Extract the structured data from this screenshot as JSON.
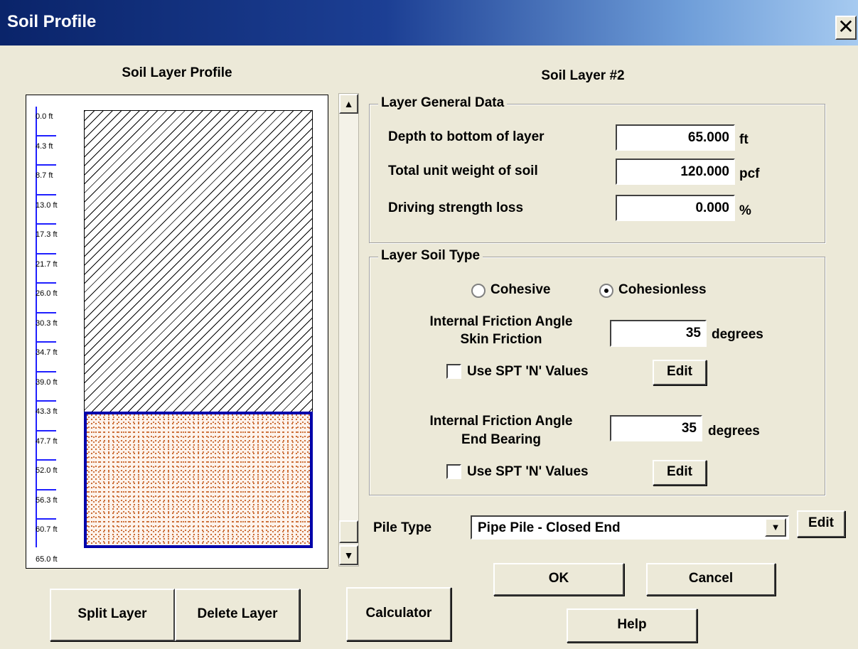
{
  "window": {
    "title": "Soil Profile",
    "close_glyph": "✕"
  },
  "profile": {
    "heading": "Soil Layer Profile",
    "depth_labels": [
      "0.0 ft",
      "4.3 ft",
      "8.7 ft",
      "13.0 ft",
      "17.3 ft",
      "21.7 ft",
      "26.0 ft",
      "30.3 ft",
      "34.7 ft",
      "39.0 ft",
      "43.3 ft",
      "47.7 ft",
      "52.0 ft",
      "56.3 ft",
      "60.7 ft",
      "65.0 ft"
    ],
    "layers": [
      {
        "pattern": "diagonal-hatch"
      },
      {
        "pattern": "sand-dots",
        "selected": true,
        "border_color": "#0000aa"
      }
    ]
  },
  "scroll": {
    "up_glyph": "▲",
    "down_glyph": "▼"
  },
  "layer_heading": "Soil Layer #2",
  "general": {
    "title": "Layer General Data",
    "depth": {
      "label": "Depth to bottom of layer",
      "value": "65.000",
      "unit": "ft"
    },
    "weight": {
      "label": "Total unit weight of soil",
      "value": "120.000",
      "unit": "pcf"
    },
    "loss": {
      "label": "Driving strength loss",
      "value": "0.000",
      "unit": "%"
    }
  },
  "soiltype": {
    "title": "Layer Soil Type",
    "cohesive_label": "Cohesive",
    "cohesionless_label": "Cohesionless",
    "selected": "cohesionless",
    "skin": {
      "label_line1": "Internal Friction Angle",
      "label_line2": "Skin Friction",
      "value": "35",
      "unit": "degrees",
      "spt_label": "Use SPT 'N' Values",
      "spt_checked": false,
      "edit_label": "Edit"
    },
    "end": {
      "label_line1": "Internal Friction Angle",
      "label_line2": "End Bearing",
      "value": "35",
      "unit": "degrees",
      "spt_label": "Use SPT 'N' Values",
      "spt_checked": false,
      "edit_label": "Edit"
    }
  },
  "pile": {
    "label": "Pile Type",
    "selected": "Pipe Pile - Closed End",
    "arrow_glyph": "▼",
    "edit_label": "Edit"
  },
  "buttons": {
    "ok": "OK",
    "cancel": "Cancel",
    "help": "Help",
    "split": "Split Layer",
    "delete": "Delete Layer",
    "calculator": "Calculator"
  },
  "icons": {
    "close": "close-icon",
    "scroll_up": "arrow-up-icon",
    "scroll_down": "arrow-down-icon",
    "dropdown": "chevron-down-icon"
  }
}
